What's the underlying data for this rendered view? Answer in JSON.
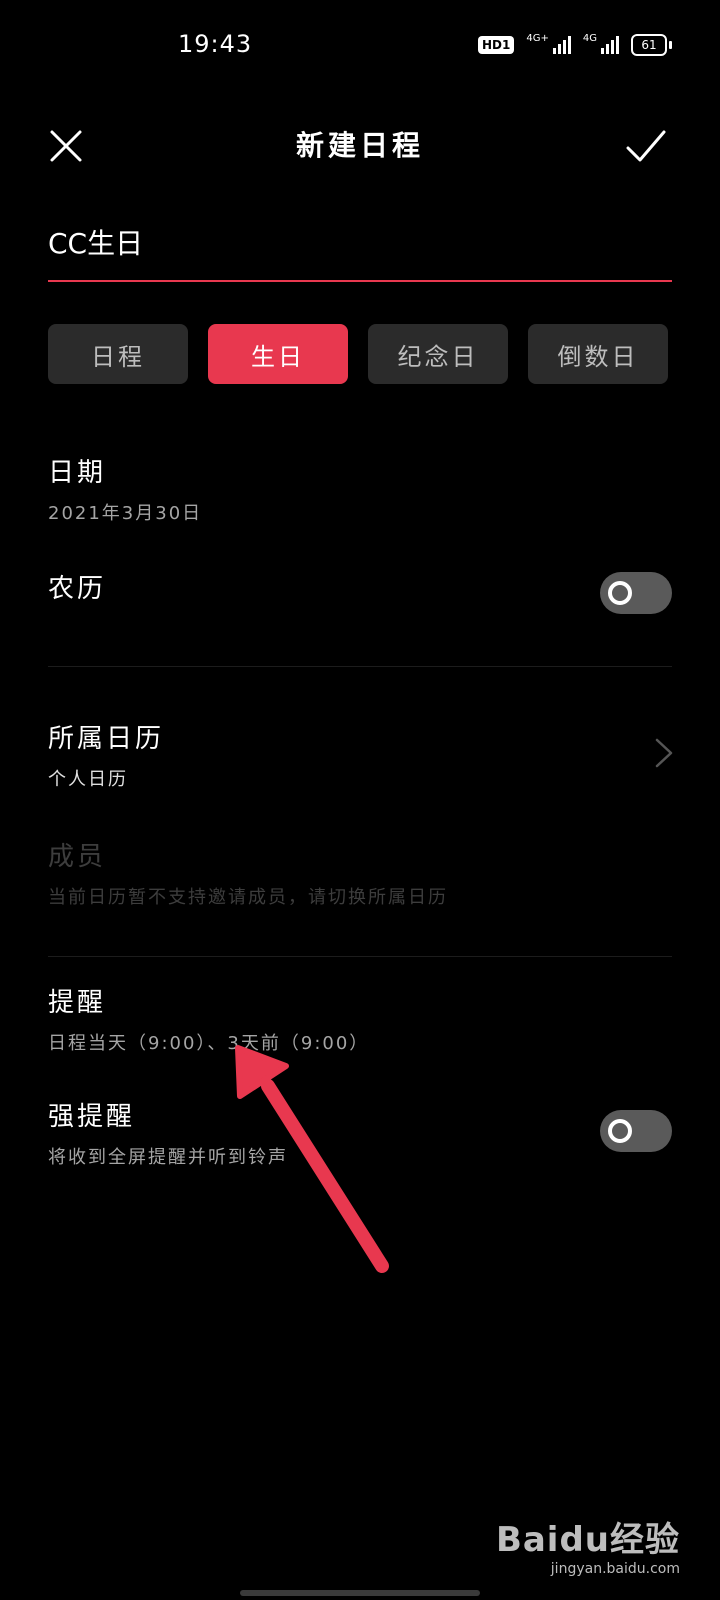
{
  "status_bar": {
    "time": "19:43",
    "hd_label": "HD1",
    "net1_label": "4G+",
    "net2_label": "4G",
    "battery": "61"
  },
  "header": {
    "title": "新建日程"
  },
  "event": {
    "name_value": "CC生日"
  },
  "tabs": [
    {
      "label": "日程",
      "active": false
    },
    {
      "label": "生日",
      "active": true
    },
    {
      "label": "纪念日",
      "active": false
    },
    {
      "label": "倒数日",
      "active": false
    }
  ],
  "date": {
    "title": "日期",
    "value": "2021年3月30日"
  },
  "lunar": {
    "title": "农历",
    "enabled": false
  },
  "calendar": {
    "title": "所属日历",
    "value": "个人日历"
  },
  "members": {
    "title": "成员",
    "hint": "当前日历暂不支持邀请成员，请切换所属日历"
  },
  "reminder": {
    "title": "提醒",
    "value": "日程当天（9:00）、3天前（9:00）"
  },
  "strong_reminder": {
    "title": "强提醒",
    "value": "将收到全屏提醒并听到铃声",
    "enabled": false
  },
  "watermark": {
    "logo": "Baidu经验",
    "url": "jingyan.baidu.com"
  },
  "colors": {
    "accent": "#e8384f",
    "background": "#000000",
    "tab_bg": "#2b2b2b",
    "arrow": "#e8384f"
  }
}
